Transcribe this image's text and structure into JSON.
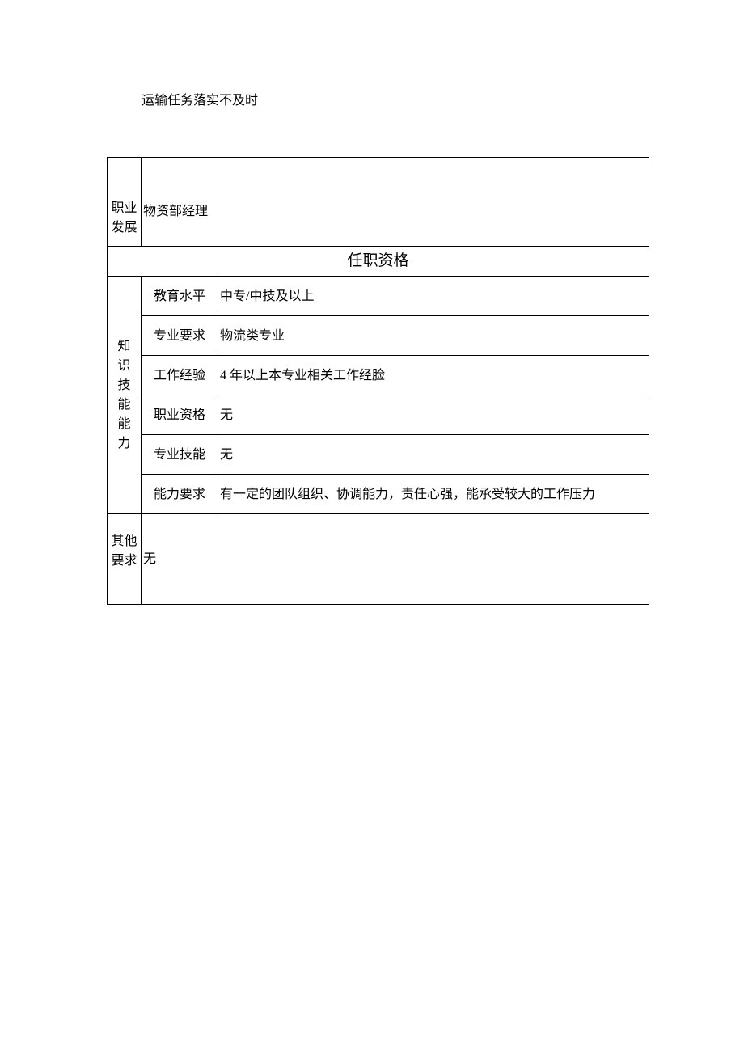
{
  "header_text": "运输任务落实不及时",
  "career": {
    "label_line1": "职业",
    "label_line2": "发展",
    "value": "物资部经理"
  },
  "section_title": "任职资格",
  "knowledge": {
    "label_c1": "知",
    "label_c2": "识",
    "label_c3": "技",
    "label_c4": "能",
    "label_c5": "能",
    "label_c6": "力",
    "rows": [
      {
        "label": "教育水平",
        "value": "中专/中技及以上"
      },
      {
        "label": "专业要求",
        "value": "物流类专业"
      },
      {
        "label": "工作经验",
        "value": "4 年以上本专业相关工作经脸"
      },
      {
        "label": "职业资格",
        "value": "无"
      },
      {
        "label": "专业技能",
        "value": "无"
      },
      {
        "label": "能力要求",
        "value": "有一定的团队组织、协调能力，责任心强，能承受较大的工作压力"
      }
    ]
  },
  "other": {
    "label_line1": "其他",
    "label_line2": "要求",
    "value": "无"
  }
}
